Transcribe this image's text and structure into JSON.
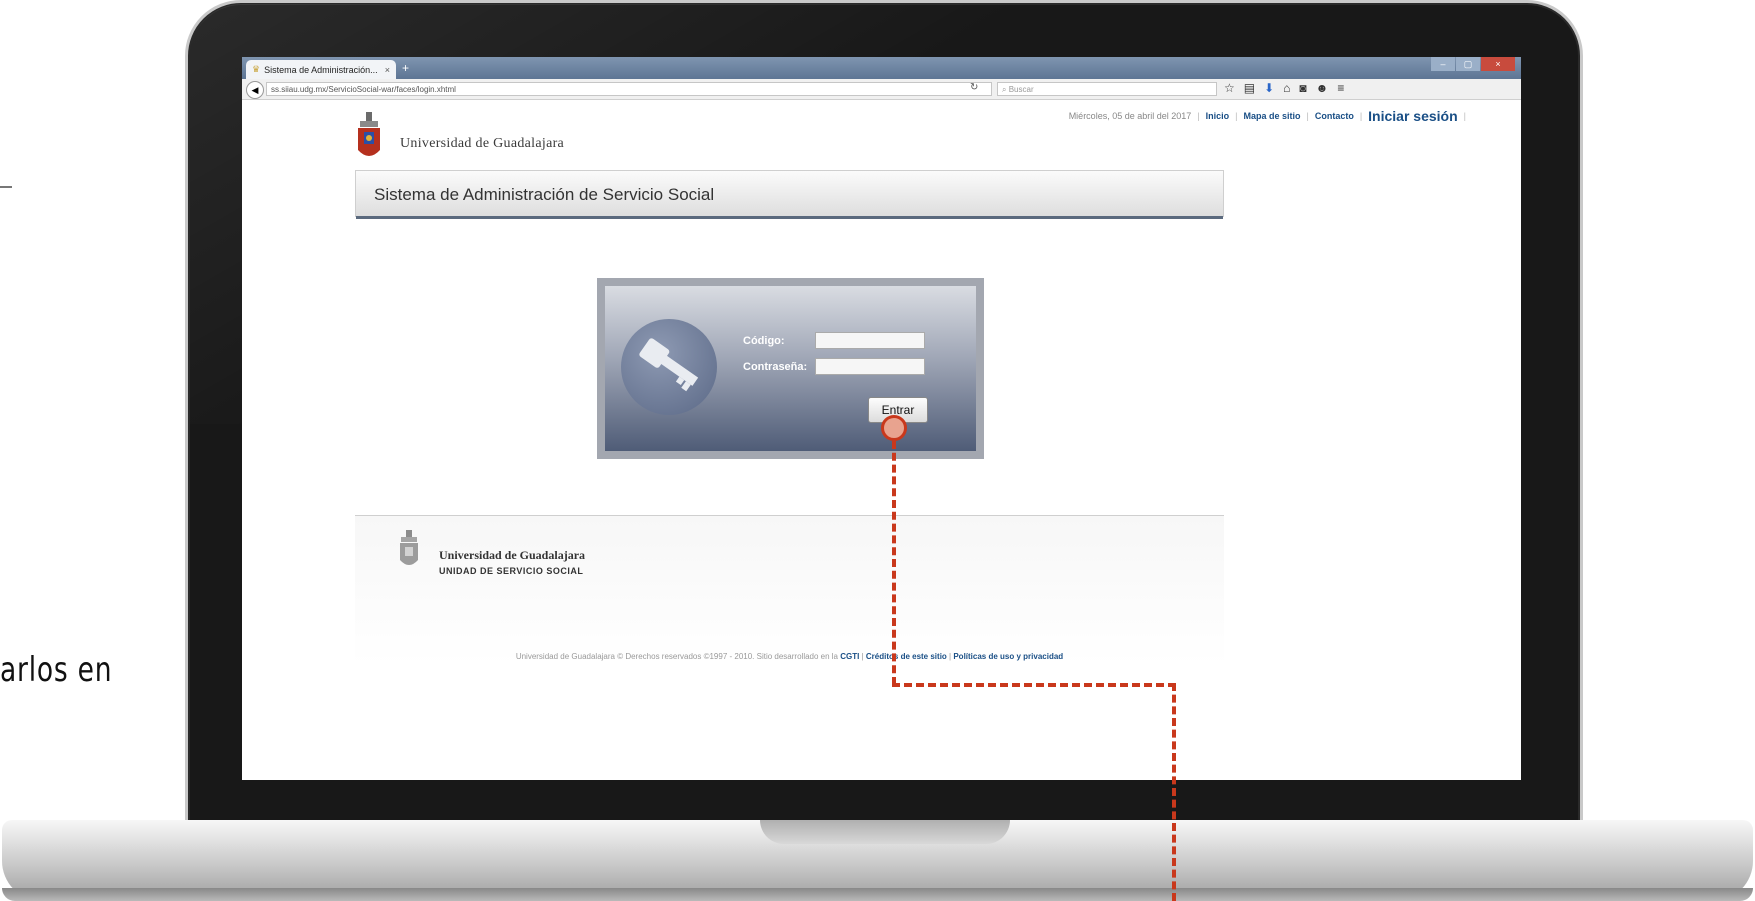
{
  "side": {
    "text": "arlos en"
  },
  "browser": {
    "tab_title": "Sistema de Administración...",
    "tab_close": "×",
    "new_tab": "+",
    "url": "ss.siiau.udg.mx/ServicioSocial-war/faces/login.xhtml",
    "search_placeholder": "Buscar",
    "window_controls": [
      "–",
      "▢",
      "×"
    ]
  },
  "header": {
    "date": "Miércoles, 05 de abril del 2017",
    "links": [
      "Inicio",
      "Mapa de sitio",
      "Contacto"
    ],
    "login": "Iniciar sesión",
    "university": "Universidad de Guadalajara"
  },
  "titlebar": {
    "label": "Sistema de Administración de Servicio Social"
  },
  "login": {
    "codigo_label": "Código:",
    "password_label": "Contraseña:",
    "button": "Entrar"
  },
  "footer": {
    "university": "Universidad de Guadalajara",
    "unit": "UNIDAD DE SERVICIO SOCIAL",
    "copyright_prefix": "Universidad de Guadalajara © Derechos reservados ©1997 - 2010. Sitio desarrollado en la",
    "links": [
      "CGTI",
      "Créditos de este sitio",
      "Políticas de uso y privacidad"
    ]
  },
  "colors": {
    "annotation": "#c9381c",
    "link": "#1a4f86"
  },
  "icons": [
    "back-arrow-icon",
    "reload-icon",
    "search-icon",
    "star-icon",
    "bookmark-icon",
    "download-icon",
    "home-icon",
    "pocket-icon",
    "chat-icon",
    "menu-icon",
    "key-icon",
    "udg-logo-icon"
  ]
}
